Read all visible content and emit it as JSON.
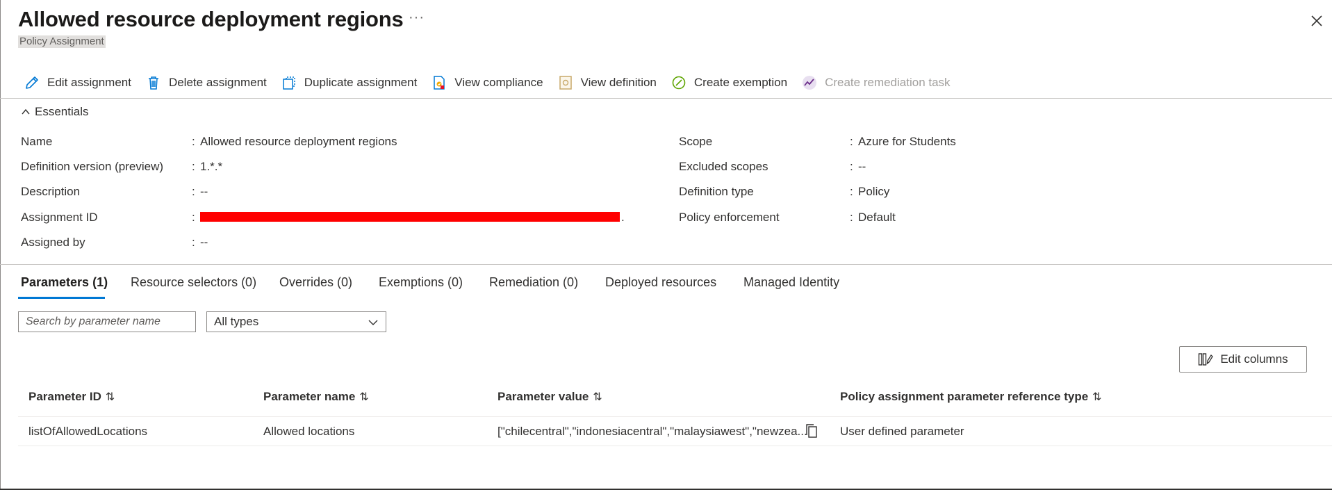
{
  "header": {
    "title": "Allowed resource deployment regions",
    "subtitle": "Policy Assignment",
    "more": "···"
  },
  "toolbar": {
    "items": [
      {
        "label": "Edit assignment",
        "icon": "pencil-icon"
      },
      {
        "label": "Delete assignment",
        "icon": "trash-icon"
      },
      {
        "label": "Duplicate assignment",
        "icon": "duplicate-icon"
      },
      {
        "label": "View compliance",
        "icon": "compliance-icon"
      },
      {
        "label": "View definition",
        "icon": "definition-icon"
      },
      {
        "label": "Create exemption",
        "icon": "exemption-icon"
      },
      {
        "label": "Create remediation task",
        "icon": "remediation-icon",
        "disabled": true
      }
    ]
  },
  "essentials": {
    "label": "Essentials",
    "left": [
      {
        "label": "Name",
        "value": "Allowed resource deployment regions"
      },
      {
        "label": "Definition version (preview)",
        "value": "1.*.*"
      },
      {
        "label": "Description",
        "value": "--"
      },
      {
        "label": "Assignment ID",
        "value": "."
      },
      {
        "label": "Assigned by",
        "value": "--"
      }
    ],
    "right": [
      {
        "label": "Scope",
        "value": "Azure for Students"
      },
      {
        "label": "Excluded scopes",
        "value": "--"
      },
      {
        "label": "Definition type",
        "value": "Policy"
      },
      {
        "label": "Policy enforcement",
        "value": "Default"
      }
    ]
  },
  "tabs": [
    {
      "label": "Parameters (1)",
      "active": true
    },
    {
      "label": "Resource selectors (0)"
    },
    {
      "label": "Overrides (0)"
    },
    {
      "label": "Exemptions (0)"
    },
    {
      "label": "Remediation (0)"
    },
    {
      "label": "Deployed resources"
    },
    {
      "label": "Managed Identity"
    }
  ],
  "filters": {
    "search_placeholder": "Search by parameter name",
    "type_selected": "All types"
  },
  "edit_columns_label": "Edit columns",
  "table": {
    "columns": [
      "Parameter ID",
      "Parameter name",
      "Parameter value",
      "Policy assignment parameter reference type"
    ],
    "rows": [
      [
        "listOfAllowedLocations",
        "Allowed locations",
        "[\"chilecentral\",\"indonesiacentral\",\"malaysiawest\",\"newzea...",
        "User defined parameter"
      ]
    ]
  },
  "colors": {
    "accent": "#0078d4",
    "redaction": "#ff0000"
  }
}
